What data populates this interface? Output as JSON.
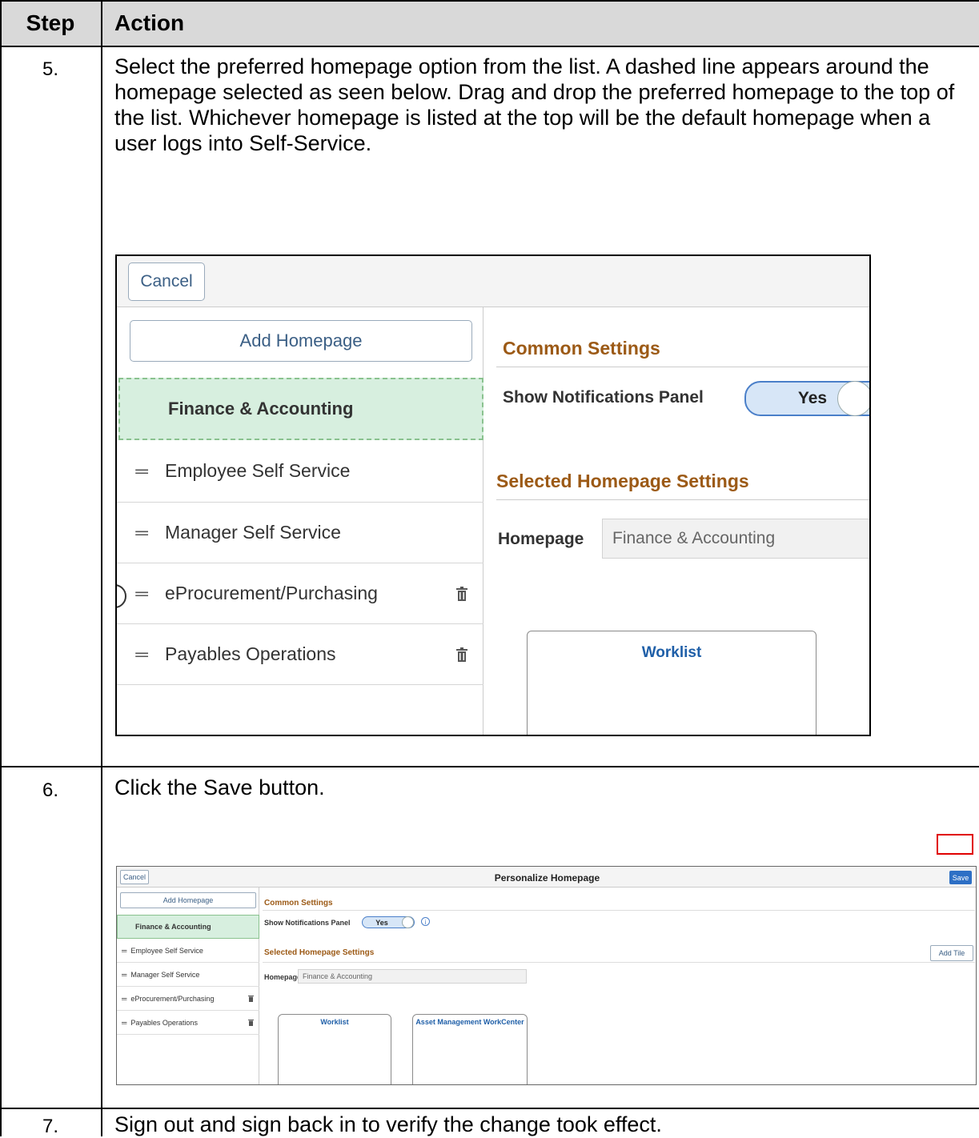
{
  "table": {
    "headers": {
      "step": "Step",
      "action": "Action"
    },
    "rows": [
      {
        "step": "5.",
        "text": "Select the preferred homepage option from the list. A dashed line appears around the homepage selected as seen below. Drag and drop the preferred homepage to the top of the list. Whichever homepage is listed at the top will be the default homepage when a user logs into Self-Service."
      },
      {
        "step": "6.",
        "text": "Click the Save button."
      },
      {
        "step": "7.",
        "text": "Sign out and sign back in to verify the change took effect."
      }
    ]
  },
  "screenshot_large": {
    "cancel": "Cancel",
    "add_homepage": "Add Homepage",
    "homepages": [
      "Finance & Accounting",
      "Employee Self Service",
      "Manager Self Service",
      "eProcurement/Purchasing",
      "Payables Operations"
    ],
    "common_settings": "Common Settings",
    "show_notifications_label": "Show Notifications Panel",
    "toggle_value": "Yes",
    "selected_settings": "Selected Homepage Settings",
    "homepage_label": "Homepage",
    "homepage_value": "Finance & Accounting",
    "tile": "Worklist",
    "drag_icon": "drag-handle-icon",
    "delete_icon": "trash-icon"
  },
  "screenshot_small": {
    "cancel": "Cancel",
    "title": "Personalize Homepage",
    "save": "Save",
    "add_homepage": "Add Homepage",
    "homepages": [
      "Finance & Accounting",
      "Employee Self Service",
      "Manager Self Service",
      "eProcurement/Purchasing",
      "Payables Operations"
    ],
    "common_settings": "Common Settings",
    "show_notifications_label": "Show Notifications Panel",
    "toggle_value": "Yes",
    "selected_settings": "Selected Homepage Settings",
    "add_tile": "Add Tile",
    "homepage_label": "Homepage",
    "homepage_value": "Finance & Accounting",
    "tiles": [
      "Worklist",
      "Asset Management WorkCenter"
    ],
    "highlight_color": "#e00000"
  }
}
